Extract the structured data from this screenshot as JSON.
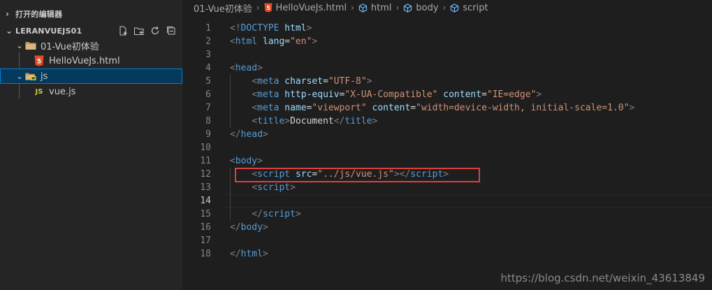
{
  "explorer": {
    "open_editors_label": "打开的编辑器",
    "workspace_label": "LERANVUEJS01",
    "tree": [
      {
        "label": "01-Vue初体验",
        "icon": "folder-icon",
        "depth": 1
      },
      {
        "label": "HelloVueJs.html",
        "icon": "html5-icon",
        "depth": 2
      },
      {
        "label": "js",
        "icon": "js-folder-icon",
        "depth": 1,
        "selected": true
      },
      {
        "label": "vue.js",
        "icon": "js-file-icon",
        "icon_text": "JS",
        "depth": 2
      }
    ]
  },
  "breadcrumbs": [
    "01-Vue初体验",
    "HelloVueJs.html",
    "html",
    "body",
    "script"
  ],
  "editor": {
    "lines": [
      {
        "n": "1",
        "tokens": [
          [
            "p",
            "<!"
          ],
          [
            "t",
            "DOCTYPE"
          ],
          [
            "x",
            " "
          ],
          [
            "a",
            "html"
          ],
          [
            "p",
            ">"
          ]
        ]
      },
      {
        "n": "2",
        "tokens": [
          [
            "p",
            "<"
          ],
          [
            "t",
            "html"
          ],
          [
            "x",
            " "
          ],
          [
            "a",
            "lang"
          ],
          [
            "x",
            "="
          ],
          [
            "s",
            "\"en\""
          ],
          [
            "p",
            ">"
          ]
        ]
      },
      {
        "n": "3",
        "tokens": []
      },
      {
        "n": "4",
        "tokens": [
          [
            "p",
            "<"
          ],
          [
            "t",
            "head"
          ],
          [
            "p",
            ">"
          ]
        ]
      },
      {
        "n": "5",
        "tokens": [
          [
            "x",
            "    "
          ],
          [
            "p",
            "<"
          ],
          [
            "t",
            "meta"
          ],
          [
            "x",
            " "
          ],
          [
            "a",
            "charset"
          ],
          [
            "x",
            "="
          ],
          [
            "s",
            "\"UTF-8\""
          ],
          [
            "p",
            ">"
          ]
        ]
      },
      {
        "n": "6",
        "tokens": [
          [
            "x",
            "    "
          ],
          [
            "p",
            "<"
          ],
          [
            "t",
            "meta"
          ],
          [
            "x",
            " "
          ],
          [
            "a",
            "http-equiv"
          ],
          [
            "x",
            "="
          ],
          [
            "s",
            "\"X-UA-Compatible\""
          ],
          [
            "x",
            " "
          ],
          [
            "a",
            "content"
          ],
          [
            "x",
            "="
          ],
          [
            "s",
            "\"IE=edge\""
          ],
          [
            "p",
            ">"
          ]
        ]
      },
      {
        "n": "7",
        "tokens": [
          [
            "x",
            "    "
          ],
          [
            "p",
            "<"
          ],
          [
            "t",
            "meta"
          ],
          [
            "x",
            " "
          ],
          [
            "a",
            "name"
          ],
          [
            "x",
            "="
          ],
          [
            "s",
            "\"viewport\""
          ],
          [
            "x",
            " "
          ],
          [
            "a",
            "content"
          ],
          [
            "x",
            "="
          ],
          [
            "s",
            "\"width=device-width, initial-scale=1.0\""
          ],
          [
            "p",
            ">"
          ]
        ]
      },
      {
        "n": "8",
        "tokens": [
          [
            "x",
            "    "
          ],
          [
            "p",
            "<"
          ],
          [
            "t",
            "title"
          ],
          [
            "p",
            ">"
          ],
          [
            "x",
            "Document"
          ],
          [
            "p",
            "</"
          ],
          [
            "t",
            "title"
          ],
          [
            "p",
            ">"
          ]
        ]
      },
      {
        "n": "9",
        "tokens": [
          [
            "p",
            "</"
          ],
          [
            "t",
            "head"
          ],
          [
            "p",
            ">"
          ]
        ]
      },
      {
        "n": "10",
        "tokens": []
      },
      {
        "n": "11",
        "tokens": [
          [
            "p",
            "<"
          ],
          [
            "t",
            "body"
          ],
          [
            "p",
            ">"
          ]
        ]
      },
      {
        "n": "12",
        "tokens": [
          [
            "x",
            "    "
          ],
          [
            "p",
            "<"
          ],
          [
            "t",
            "script"
          ],
          [
            "x",
            " "
          ],
          [
            "a",
            "src"
          ],
          [
            "x",
            "="
          ],
          [
            "s",
            "\"../js/vue.js\""
          ],
          [
            "p",
            "></"
          ],
          [
            "t",
            "script"
          ],
          [
            "p",
            ">"
          ]
        ]
      },
      {
        "n": "13",
        "tokens": [
          [
            "x",
            "    "
          ],
          [
            "p",
            "<"
          ],
          [
            "t",
            "script"
          ],
          [
            "p",
            ">"
          ]
        ]
      },
      {
        "n": "14",
        "tokens": [],
        "active": true
      },
      {
        "n": "15",
        "tokens": [
          [
            "x",
            "    "
          ],
          [
            "p",
            "</"
          ],
          [
            "t",
            "script"
          ],
          [
            "p",
            ">"
          ]
        ]
      },
      {
        "n": "16",
        "tokens": [
          [
            "p",
            "</"
          ],
          [
            "t",
            "body"
          ],
          [
            "p",
            ">"
          ]
        ]
      },
      {
        "n": "17",
        "tokens": []
      },
      {
        "n": "18",
        "tokens": [
          [
            "p",
            "</"
          ],
          [
            "t",
            "html"
          ],
          [
            "p",
            ">"
          ]
        ]
      }
    ]
  },
  "watermark": "https://blog.csdn.net/weixin_43613849",
  "colors": {
    "tag": "#569cd6",
    "attribute": "#9cdcfe",
    "string": "#ce9178",
    "punctuation": "#808080",
    "text": "#d4d4d4",
    "highlight_box": "#e04040",
    "selection": "#04395e"
  }
}
